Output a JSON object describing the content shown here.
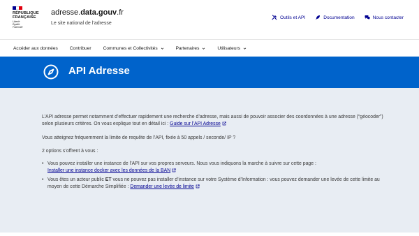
{
  "header": {
    "logo_text": "RÉPUBLIQUE FRANÇAISE",
    "logo_line1": "RÉPUBLIQUE",
    "logo_line2": "FRANÇAISE",
    "devise": [
      "Liberté",
      "Égalité",
      "Fraternité"
    ],
    "site_name_prefix": "adresse.",
    "site_name_bold": "data.gouv",
    "site_name_suffix": ".fr",
    "tagline": "Le site national de l’adresse",
    "tools": [
      {
        "label": "Outils et API",
        "icon": "tools-icon"
      },
      {
        "label": "Documentation",
        "icon": "feather-icon"
      },
      {
        "label": "Nous contacter",
        "icon": "chat-icon"
      }
    ]
  },
  "nav": {
    "items": [
      {
        "label": "Accéder aux données",
        "dropdown": false
      },
      {
        "label": "Contribuer",
        "dropdown": false
      },
      {
        "label": "Communes et Collectivités",
        "dropdown": true
      },
      {
        "label": "Partenaires",
        "dropdown": true
      },
      {
        "label": "Utilisateurs",
        "dropdown": true
      }
    ]
  },
  "banner": {
    "title": "API Adresse",
    "icon": "compass-icon",
    "color": "#0063cb"
  },
  "content": {
    "p1_text": "L’API adresse permet notamment d’effectuer rapidement une recherche d’adresse, mais aussi de pouvoir associer des coordonnées à une adresse (“géocoder”) selon plusieurs critères. On vous explique tout en détail ici : ",
    "p1_link": "Guide sur l’API Adresse",
    "p2": "Vous atteignez fréquemment la limite de requête de l’API, fixée à 50 appels / seconde/ IP ?",
    "p3": "2 options s’offrent à vous :",
    "opt1_text": "Vous pouvez installer une instance de l’API sur vos propres serveurs. Nous vous indiquons la marche à suivre sur cette page : ",
    "opt1_link": "Installer une instance docker avec les données de la BAN",
    "opt2_pre": "Vous êtes un acteur public ",
    "opt2_bold": "ET",
    "opt2_post": " vous ne pouvez pas installer d’instance sur votre Système d’Information : vous pouvez demander une levée de cette limite au moyen de cette Démarche Simplifiée : ",
    "opt2_link": "Demander une levée de limite",
    "background": "#e8edf3",
    "link_color": "#000091"
  }
}
